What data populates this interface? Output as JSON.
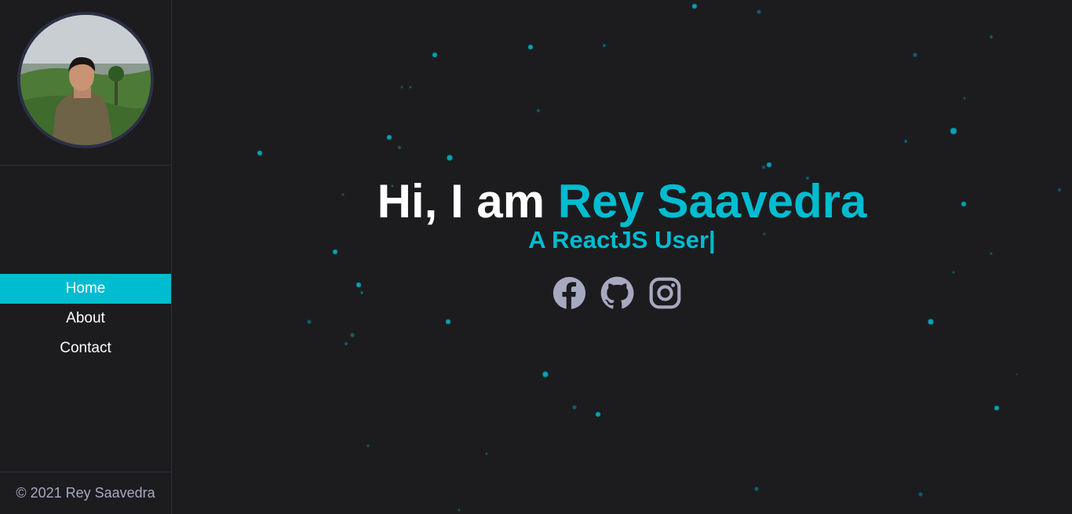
{
  "sidebar": {
    "nav": [
      {
        "label": "Home",
        "active": true
      },
      {
        "label": "About",
        "active": false
      },
      {
        "label": "Contact",
        "active": false
      }
    ],
    "footer": "© 2021 Rey Saavedra"
  },
  "hero": {
    "greeting": "Hi, I am ",
    "name": "Rey Saavedra",
    "subtitle": "A ReactJS User|"
  },
  "socials": [
    {
      "icon": "facebook-icon"
    },
    {
      "icon": "github-icon"
    },
    {
      "icon": "instagram-icon"
    }
  ],
  "colors": {
    "accent": "#00bcd0",
    "background": "#1c1c1f",
    "icon": "#a6a9c0"
  }
}
